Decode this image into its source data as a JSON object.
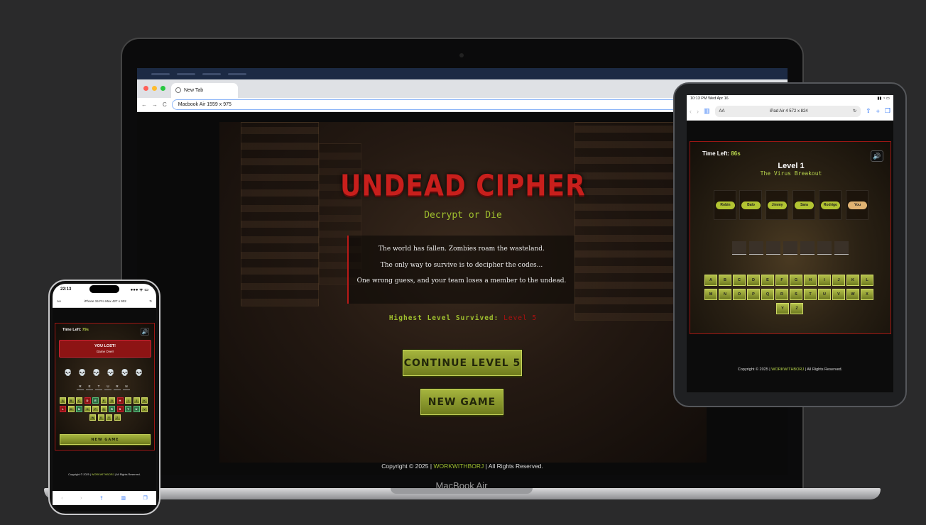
{
  "macbook": {
    "device_label": "MacBook Air",
    "tab_title": "New Tab",
    "address": "Macbook Air  1559 x 975",
    "game": {
      "title": "UNDEAD CIPHER",
      "subtitle": "Decrypt or Die",
      "story": [
        "The world has fallen. Zombies roam the wasteland.",
        "The only way to survive is to decipher the codes...",
        "One wrong guess, and your team loses a member to the undead."
      ],
      "highest_label": "Highest Level Survived:",
      "highest_value": "Level 5",
      "continue_button": "CONTINUE LEVEL 5",
      "new_game_button": "NEW GAME"
    },
    "footer": {
      "prefix": "Copyright © 2025 |",
      "brand": "WORKWITHBORJ",
      "suffix": "| All Rights Reserved."
    }
  },
  "ipad": {
    "status_time": "10:13 PM  Wed Apr 16",
    "status_right": "86%",
    "text_size_label": "AA",
    "address": "iPad Air 4  572 x 824",
    "game": {
      "time_label": "Time Left:",
      "time_value": "86s",
      "sound_icon": "speaker-icon",
      "level": "Level 1",
      "level_subtitle": "The Virus Breakout",
      "team": [
        "Robin",
        "Balo",
        "Jimmy",
        "Sara",
        "Rodrigo",
        "You"
      ],
      "word_length": 7,
      "keys_row1": [
        "A",
        "B",
        "C",
        "D",
        "E",
        "F",
        "G",
        "H",
        "I",
        "J",
        "K",
        "L"
      ],
      "keys_row2": [
        "M",
        "N",
        "O",
        "P",
        "Q",
        "R",
        "S",
        "T",
        "U",
        "V",
        "W",
        "X"
      ],
      "keys_row3": [
        "Y",
        "Z"
      ]
    },
    "footer": {
      "prefix": "Copyright © 2025 |",
      "brand": "WORKWITHBORJ",
      "suffix": "| All Rights Reserved."
    }
  },
  "iphone": {
    "status_time": "22:13",
    "status_right": "●●● ᯤ ▭",
    "text_size_label": "AA",
    "address": "iPhone 15 Pro Max  427 x 932",
    "game": {
      "time_label": "Time Left:",
      "time_value": "79s",
      "lost_title": "YOU LOST!",
      "lost_sub": "Game Over!",
      "skulls": 6,
      "answer": [
        "R",
        "E",
        "T",
        "U",
        "R",
        "N"
      ],
      "new_game_button": "NEW GAME"
    },
    "footer": {
      "prefix": "Copyright © 2025 |",
      "brand": "WORKWITHBORJ",
      "suffix": "| All Rights Reserved."
    }
  },
  "colors": {
    "accent_green": "#9fbf2e",
    "blood_red": "#c81f1c",
    "background": "#2a2a2b"
  }
}
